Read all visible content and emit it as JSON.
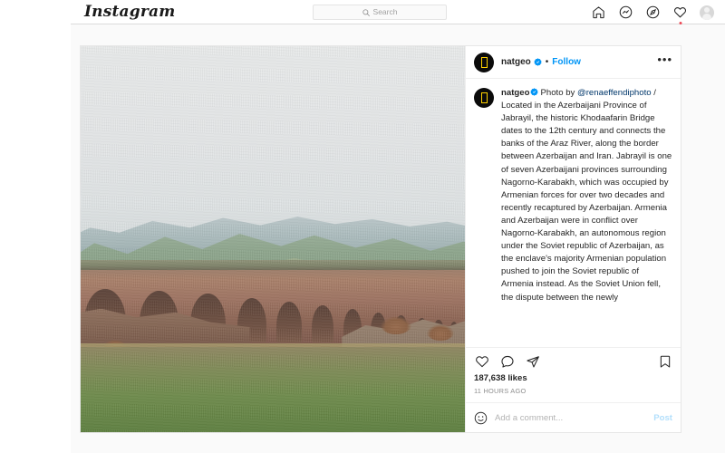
{
  "nav": {
    "logo_text": "Instagram",
    "search": {
      "placeholder": "Search",
      "icon": "search-icon"
    },
    "icons": [
      {
        "name": "home-icon",
        "label": "Home"
      },
      {
        "name": "messenger-icon",
        "label": "Messages"
      },
      {
        "name": "compass-icon",
        "label": "Explore"
      },
      {
        "name": "heart-icon",
        "label": "Notifications",
        "has_badge": true
      },
      {
        "name": "profile-avatar-icon",
        "label": "Profile"
      }
    ]
  },
  "post": {
    "author": {
      "username": "natgeo",
      "verified": true,
      "verified_icon": "verified-badge-icon",
      "avatar_icon": "natgeo-logo-avatar"
    },
    "separator": "•",
    "follow_label": "Follow",
    "more_options_label": "•••",
    "media": {
      "alt": "Historic Khodaafarin Bridge of stone arches over the Araz River with green mountains behind"
    },
    "caption": {
      "username": "natgeo",
      "body_before_mention": "Photo by ",
      "mention": "@renaeffendiphoto",
      "body": " / Located in the Azerbaijani Province of Jabrayil, the historic Khodaafarin Bridge dates to the 12th century and connects the banks of the Araz River, along the border between Azerbaijan and Iran. Jabrayil is one of seven Azerbaijani provinces surrounding Nagorno-Karabakh, which was occupied by Armenian forces for over two decades and recently recaptured by Azerbaijan. Armenia and Azerbaijan were in conflict over Nagorno-Karabakh, an autonomous region under the Soviet republic of Azerbaijan, as the enclave's majority Armenian population pushed to join the Soviet republic of Armenia instead. As the Soviet Union fell, the dispute between the newly"
    },
    "actions": [
      {
        "name": "like-button",
        "icon": "heart-icon"
      },
      {
        "name": "comment-button",
        "icon": "comment-bubble-icon"
      },
      {
        "name": "share-button",
        "icon": "paper-plane-icon"
      },
      {
        "name": "save-button",
        "icon": "bookmark-icon"
      }
    ],
    "likes_text": "187,638 likes",
    "timestamp": "11 HOURS AGO",
    "composer": {
      "emoji_icon": "smiley-face-icon",
      "placeholder": "Add a comment...",
      "value": "",
      "post_label": "Post"
    }
  },
  "colors": {
    "accent_blue": "#0095f6",
    "post_button_blue": "#b2dffc",
    "mention_blue": "#00376b",
    "badge_red": "#ed4956",
    "text_primary": "#262626",
    "text_muted": "#8e8e8e",
    "border": "#efefef",
    "page_bg": "#fafafa",
    "natgeo_yellow": "#ffd200"
  }
}
